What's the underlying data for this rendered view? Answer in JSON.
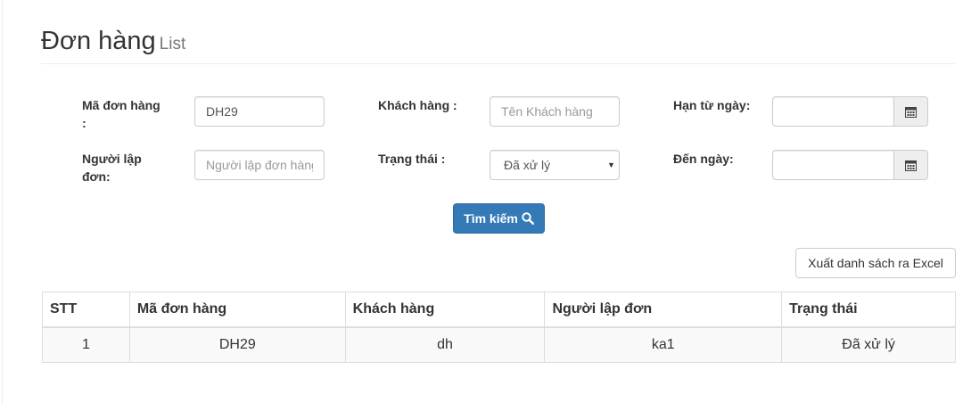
{
  "header": {
    "title": "Đơn hàng",
    "subtitle": "List"
  },
  "filters": {
    "order_code": {
      "label_line1": "Mã đơn hàng",
      "label_line2": ":",
      "value": "DH29"
    },
    "customer": {
      "label": "Khách hàng :",
      "placeholder": "Tên Khách hàng",
      "value": ""
    },
    "from_date": {
      "label": "Hạn từ ngày:",
      "value": "",
      "icon": "calendar-icon"
    },
    "creator": {
      "label_line1": "Người lập",
      "label_line2": "đơn:",
      "placeholder": "Người lập đơn hàng",
      "value": ""
    },
    "status": {
      "label": "Trạng thái :",
      "selected": "Đã xử lý"
    },
    "to_date": {
      "label": "Đến ngày:",
      "value": "",
      "icon": "calendar-icon"
    }
  },
  "actions": {
    "search_label": "Tìm kiếm",
    "search_icon": "search-icon",
    "export_label": "Xuất danh sách ra Excel"
  },
  "table": {
    "headers": {
      "stt": "STT",
      "code": "Mã đơn hàng",
      "customer": "Khách hàng",
      "creator": "Người lập đơn",
      "status": "Trạng thái"
    },
    "rows": [
      {
        "stt": "1",
        "code": "DH29",
        "customer": "dh",
        "creator": "ka1",
        "status": "Đã xử lý"
      }
    ]
  },
  "colors": {
    "primary": "#337ab7",
    "border": "#dddddd",
    "stripe": "#f9f9f9"
  }
}
